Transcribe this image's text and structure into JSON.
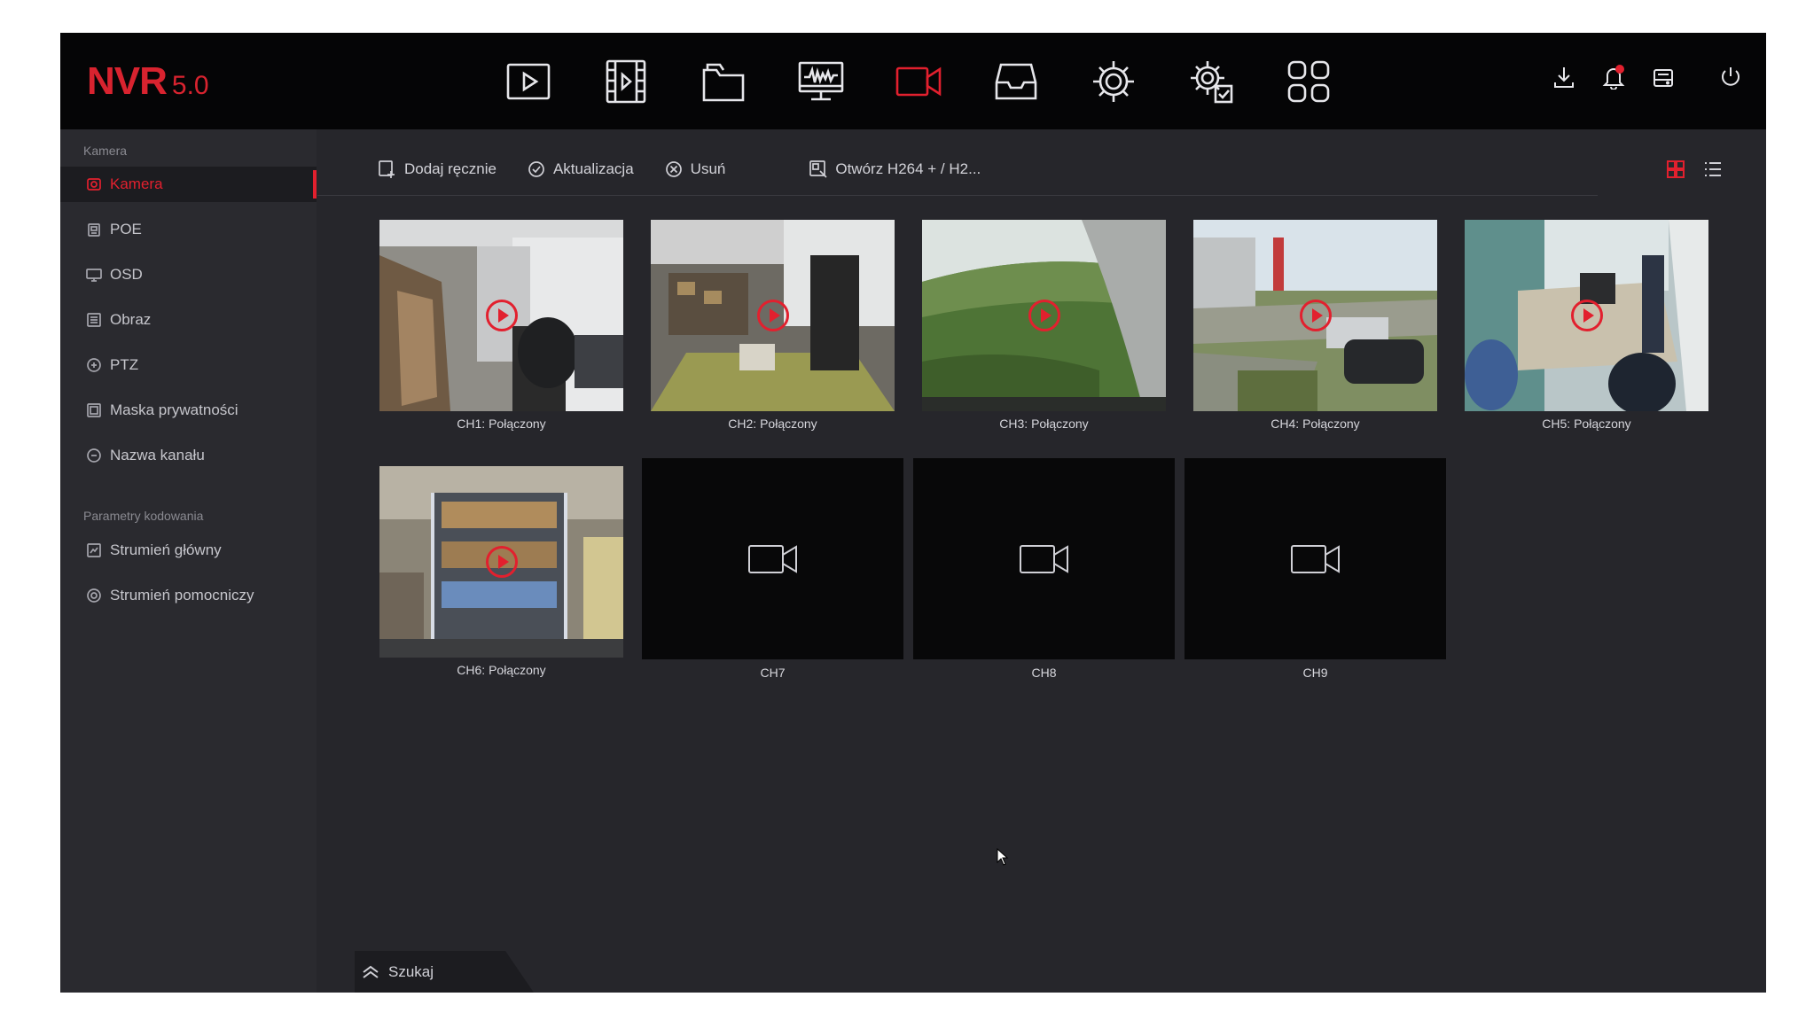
{
  "app": {
    "logo_main": "NVR",
    "logo_version": "5.0",
    "accent_color": "#e2202e",
    "top_nav": [
      {
        "icon": "playback-icon"
      },
      {
        "icon": "video-film-icon"
      },
      {
        "icon": "files-folder-icon"
      },
      {
        "icon": "monitor-waveform-icon"
      },
      {
        "icon": "camera-icon",
        "active": true
      },
      {
        "icon": "storage-tray-icon"
      },
      {
        "icon": "settings-gear-icon"
      },
      {
        "icon": "advanced-settings-icon"
      },
      {
        "icon": "apps-grid-icon"
      }
    ],
    "top_right_icons": [
      "download-icon",
      "bell-icon",
      "hdd-icon",
      "power-icon"
    ]
  },
  "sidebar": {
    "section1_title": "Kamera",
    "section1_items": [
      {
        "label": "Kamera",
        "icon": "camera-small-icon",
        "active": true
      },
      {
        "label": "POE",
        "icon": "poe-icon"
      },
      {
        "label": "OSD",
        "icon": "osd-monitor-icon"
      },
      {
        "label": "Obraz",
        "icon": "image-doc-icon"
      },
      {
        "label": "PTZ",
        "icon": "ptz-icon"
      },
      {
        "label": "Maska prywatności",
        "icon": "mask-icon"
      },
      {
        "label": "Nazwa kanału",
        "icon": "channel-name-icon"
      }
    ],
    "section2_title": "Parametry kodowania",
    "section2_items": [
      {
        "label": "Strumień główny",
        "icon": "main-stream-icon"
      },
      {
        "label": "Strumień pomocniczy",
        "icon": "sub-stream-icon"
      }
    ]
  },
  "toolbar": {
    "add_manual": "Dodaj ręcznie",
    "update": "Aktualizacja",
    "delete": "Usuń",
    "open_h264": "Otwórz H264 + / H2..."
  },
  "channels": [
    {
      "caption": "CH1: Połączony",
      "connected": true,
      "scene": "indoor-shelves"
    },
    {
      "caption": "CH2: Połączony",
      "connected": true,
      "scene": "warehouse"
    },
    {
      "caption": "CH3: Połączony",
      "connected": true,
      "scene": "grass"
    },
    {
      "caption": "CH4: Połączony",
      "connected": true,
      "scene": "parking"
    },
    {
      "caption": "CH5: Połączony",
      "connected": true,
      "scene": "office"
    },
    {
      "caption": "CH6: Połączony",
      "connected": true,
      "scene": "storage-rack"
    },
    {
      "caption": "CH7",
      "connected": false
    },
    {
      "caption": "CH8",
      "connected": false
    },
    {
      "caption": "CH9",
      "connected": false
    }
  ],
  "search_label": "Szukaj"
}
